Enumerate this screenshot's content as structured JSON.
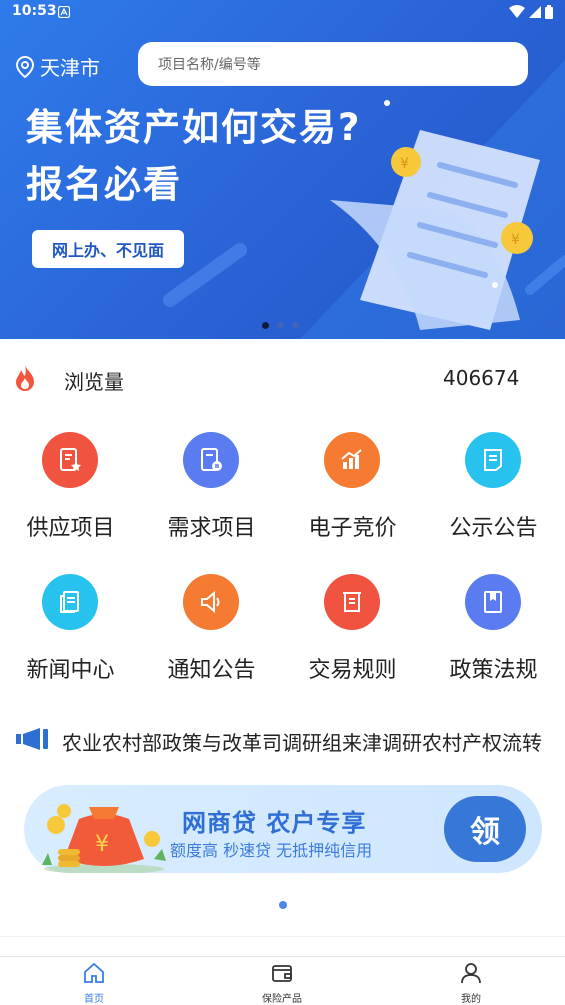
{
  "status_bar": {
    "time": "10:53"
  },
  "header": {
    "city": "天津市",
    "search_placeholder": "项目名称/编号等"
  },
  "banner": {
    "headline_line1": "集体资产如何交易?",
    "headline_line2": "报名必看",
    "button_label": "网上办、不见面",
    "page_count": 3,
    "active_page": 1
  },
  "stats": {
    "views_label": "浏览量",
    "views_count": "406674"
  },
  "menu": [
    {
      "label": "供应项目",
      "icon": "document-star-icon",
      "color": "#f0533f"
    },
    {
      "label": "需求项目",
      "icon": "document-exchange-icon",
      "color": "#5b7cf0"
    },
    {
      "label": "电子竞价",
      "icon": "bar-chart-icon",
      "color": "#f57a32"
    },
    {
      "label": "公示公告",
      "icon": "notice-board-icon",
      "color": "#27c3ee"
    },
    {
      "label": "新闻中心",
      "icon": "newspaper-icon",
      "color": "#27c3ee"
    },
    {
      "label": "通知公告",
      "icon": "speaker-icon",
      "color": "#f57a32"
    },
    {
      "label": "交易规则",
      "icon": "scroll-icon",
      "color": "#f0533f"
    },
    {
      "label": "政策法规",
      "icon": "book-bookmark-icon",
      "color": "#5b7cf0"
    }
  ],
  "notice": {
    "text": "农业农村部政策与改革司调研组来津调研农村产权流转"
  },
  "promo": {
    "title": "网商贷 农户专享",
    "subtitle": "额度高 秒速贷 无抵押纯信用",
    "button_label": "领"
  },
  "tabbar": {
    "items": [
      {
        "label": "首页",
        "icon": "home-icon",
        "active": true
      },
      {
        "label": "保险产品",
        "icon": "wallet-icon",
        "active": false
      },
      {
        "label": "我的",
        "icon": "user-icon",
        "active": false
      }
    ]
  },
  "colors": {
    "accent": "#3a7de0",
    "banner_blue": "#2a63d6"
  }
}
